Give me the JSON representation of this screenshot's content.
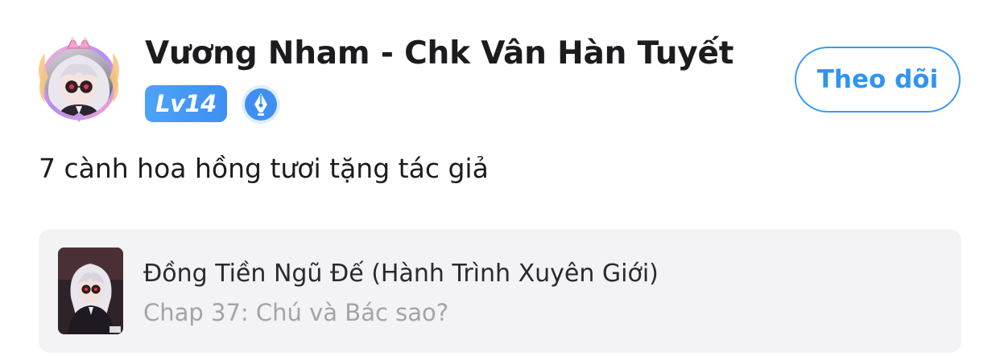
{
  "post": {
    "username": "Vương Nham - Chk Vân Hàn Tuyết",
    "level": "Lv14",
    "badge_icon": "writer-pen-icon",
    "follow_label": "Theo dõi",
    "comment": "7 cành hoa hồng tươi tặng tác giả"
  },
  "chapter_card": {
    "book_title": "Đồng Tiền Ngũ Đế (Hành Trình Xuyên Giới)",
    "chapter": "Chap 37: Chú và Bác sao?"
  },
  "colors": {
    "accent": "#2f95f0",
    "level_badge": "#4ea3f7",
    "card_background": "#f3f3f5",
    "secondary_text": "#a3a3a8"
  }
}
